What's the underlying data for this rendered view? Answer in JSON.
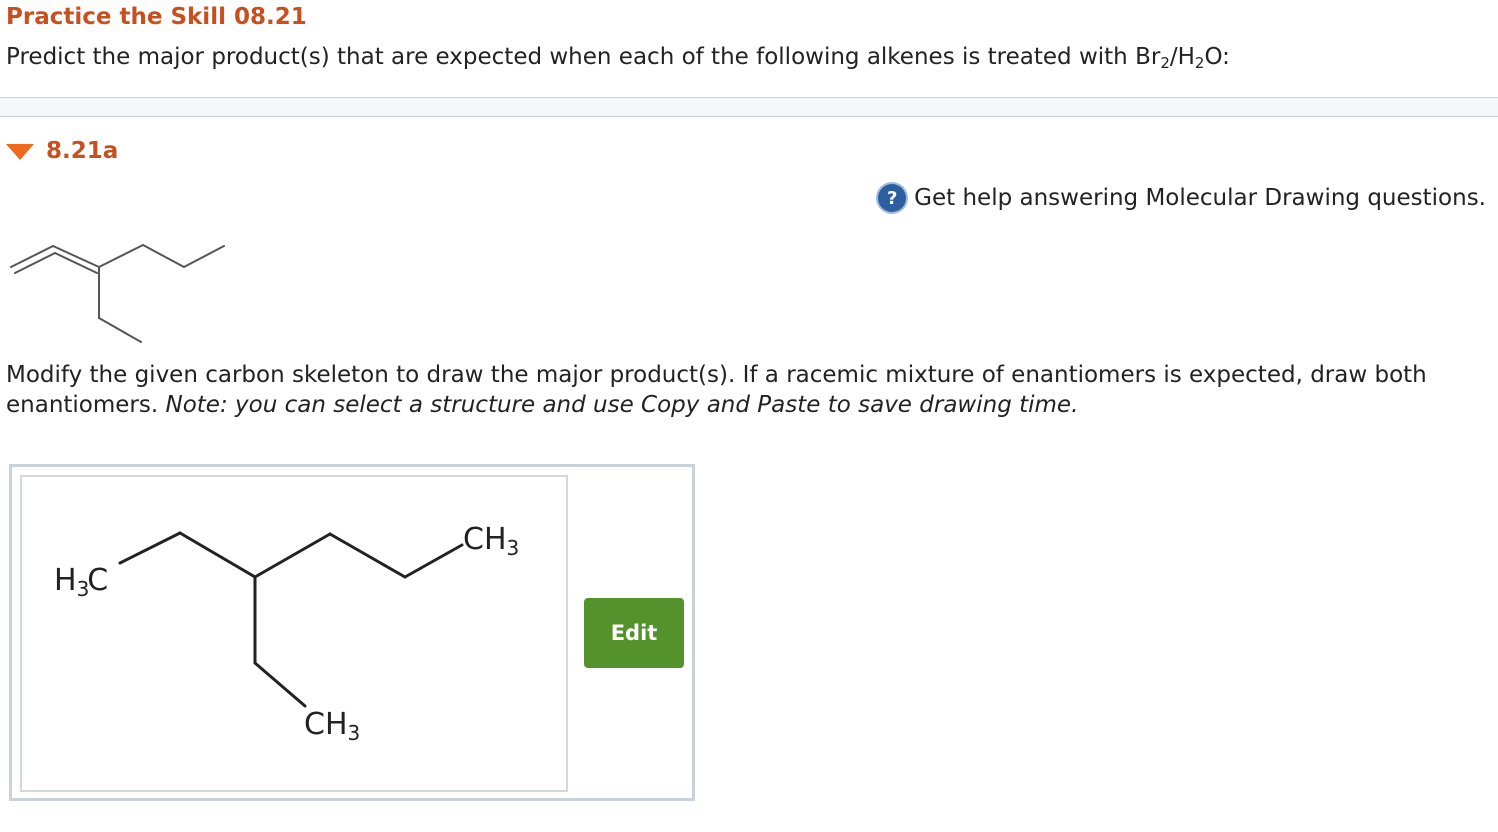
{
  "heading": "Practice the Skill 08.21",
  "prompt": {
    "text_before": "Predict the major product(s) that are expected when each of the following alkenes is treated with Br",
    "sub1": "2",
    "text_mid": "/H",
    "sub2": "2",
    "text_after": "O:"
  },
  "part": {
    "label": "8.21a",
    "expand_icon": "caret-down-icon"
  },
  "help": {
    "icon": "question-circle-icon",
    "text": "Get help answering Molecular Drawing questions."
  },
  "instructions": {
    "main": "Modify the given carbon skeleton to draw the major product(s). If a racemic mixture of enantiomers is expected, draw both enantiomers. ",
    "note": "Note: you can select a structure and use Copy and Paste to save drawing time."
  },
  "drawing": {
    "labels": {
      "left_h": "H",
      "left_sub": "3",
      "left_c": "C",
      "right_ch": "CH",
      "right_sub": "3",
      "bottom_ch": "CH",
      "bottom_sub": "3"
    },
    "edit_label": "Edit"
  },
  "colors": {
    "heading": "#c8501e",
    "caret": "#ef6a1c",
    "help_icon": "#2d5fa0",
    "edit_button": "#54922c",
    "frame_border": "#c9d1da"
  }
}
